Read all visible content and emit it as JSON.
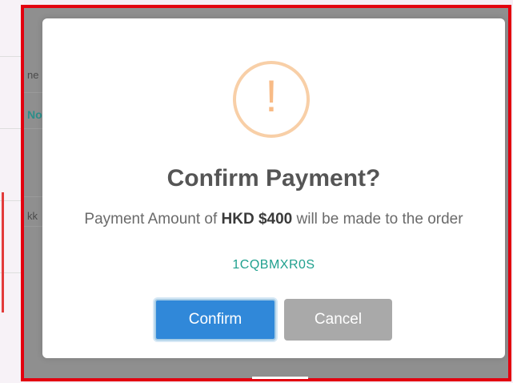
{
  "background": {
    "row_labels": [
      "ne",
      "No",
      "kk"
    ]
  },
  "modal": {
    "icon": "warning-exclamation-icon",
    "icon_glyph": "!",
    "title": "Confirm Payment?",
    "message_prefix": "Payment Amount of ",
    "amount": "HKD $400",
    "message_suffix": " will be made to the order",
    "order_code": "1CQBMXR0S"
  },
  "buttons": {
    "confirm_label": "Confirm",
    "cancel_label": "Cancel"
  },
  "colors": {
    "annotation_frame": "#e3000f",
    "confirm_button": "#3088d9",
    "cancel_button": "#a9a9a9",
    "warning_icon": "#f8bb86",
    "order_code": "#1fa08e"
  }
}
